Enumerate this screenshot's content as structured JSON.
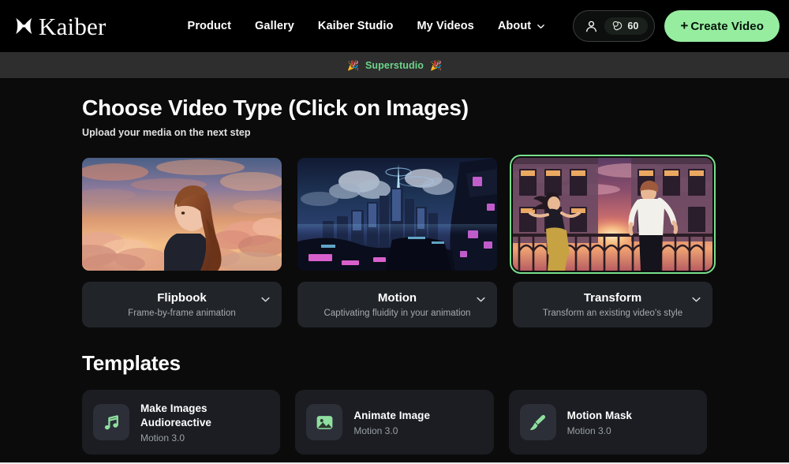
{
  "brand": {
    "name": "Kaiber",
    "logo_icon": "kaiber-butterfly-mark",
    "accent_color": "#96eda0"
  },
  "nav": {
    "links": [
      {
        "label": "Product",
        "caret": false
      },
      {
        "label": "Gallery",
        "caret": false
      },
      {
        "label": "Kaiber Studio",
        "caret": false
      },
      {
        "label": "My Videos",
        "caret": false
      },
      {
        "label": "About",
        "caret": true
      }
    ],
    "account": {
      "person_icon": "person-icon",
      "coin_icon": "coins-icon",
      "credits": "60"
    },
    "create_button": {
      "plus": "+",
      "label": "Create Video"
    }
  },
  "banner": {
    "left_emoji": "🎉",
    "right_emoji": "🎉",
    "label": "Superstudio",
    "text_color": "#6dd38a"
  },
  "main": {
    "title": "Choose Video Type (Click on Images)",
    "subtitle": "Upload your media on the next step",
    "video_types": [
      {
        "name": "Flipbook",
        "description": "Frame-by-frame animation",
        "thumbnail_alt": "anime girl in profile against sunset clouds",
        "selected": false,
        "chevron_icon": "chevron-down-icon"
      },
      {
        "name": "Motion",
        "description": "Captivating fluidity in your animation",
        "thumbnail_alt": "neon cyberpunk cityscape at night",
        "selected": false,
        "chevron_icon": "chevron-down-icon"
      },
      {
        "name": "Transform",
        "description": "Transform an existing video's style",
        "thumbnail_alt": "two figures on a balcony at sunset",
        "selected": true,
        "chevron_icon": "chevron-down-icon"
      }
    ],
    "templates_title": "Templates",
    "templates": [
      {
        "name": "Make Images Audioreactive",
        "subtitle": "Motion 3.0",
        "icon": "music-note-icon"
      },
      {
        "name": "Animate Image",
        "subtitle": "Motion 3.0",
        "icon": "image-icon"
      },
      {
        "name": "Motion Mask",
        "subtitle": "Motion 3.0",
        "icon": "paintbrush-icon"
      }
    ]
  }
}
